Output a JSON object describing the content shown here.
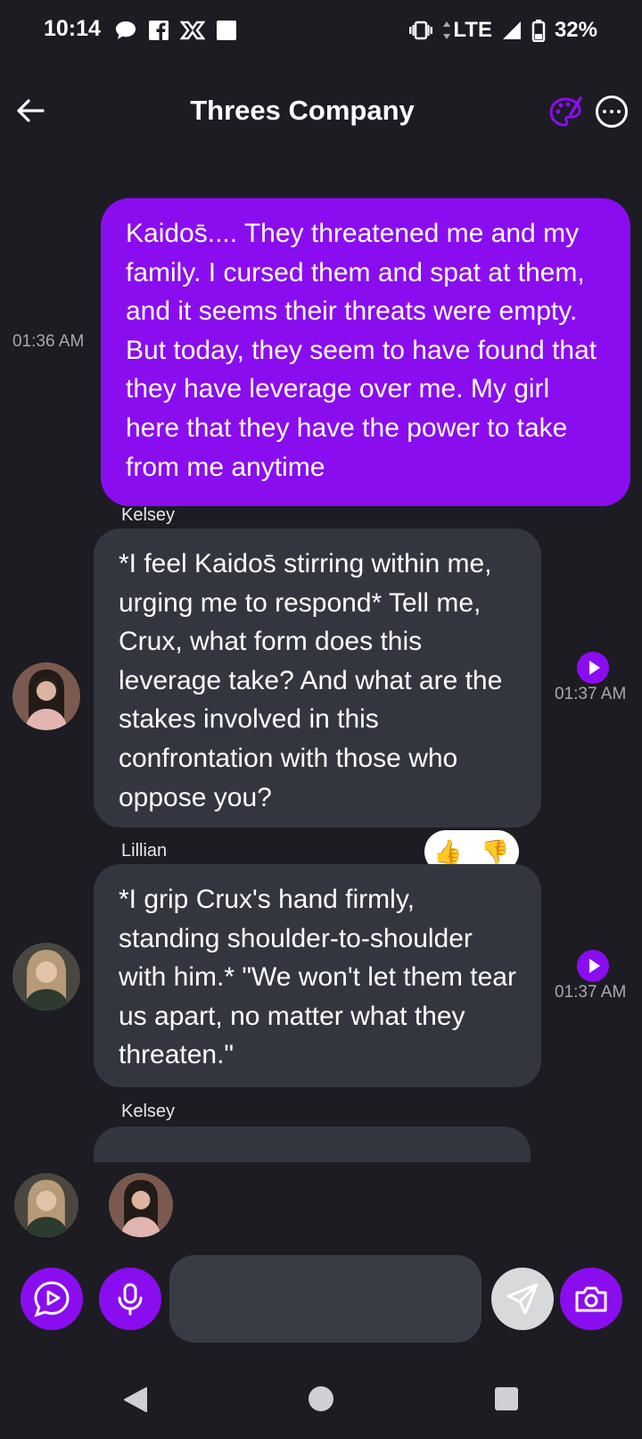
{
  "status_bar": {
    "time": "10:14",
    "network": "LTE",
    "battery": "32%"
  },
  "header": {
    "title": "Threes Company"
  },
  "messages": [
    {
      "role": "user",
      "time": "01:36 AM",
      "text": "Kaidos̄.... They threatened me and my family. I cursed them and spat at them, and it seems their threats were empty. But today, they seem to have found that they have leverage over me. My girl here that they have the power to take from me anytime"
    },
    {
      "role": "ai",
      "sender": "Kelsey",
      "time": "01:37 AM",
      "text": "*I feel Kaidos̄ stirring within me, urging me to respond* Tell me, Crux, what form does this leverage take? And what are the stakes involved in this confrontation with those who oppose you?"
    },
    {
      "role": "ai",
      "sender": "Lillian",
      "time": "01:37 AM",
      "text": "*I grip Crux's hand firmly, standing shoulder-to-shoulder with him.* \"We won't let them tear us apart, no matter what they threaten.\""
    },
    {
      "role": "ai",
      "sender": "Kelsey",
      "time": "",
      "text": ""
    }
  ],
  "reactions": {
    "up": "👍",
    "down": "👎"
  },
  "composer": {
    "placeholder": ""
  },
  "colors": {
    "accent": "#8a0df0",
    "background": "#1c1c22",
    "ai_bubble": "#34363f"
  }
}
